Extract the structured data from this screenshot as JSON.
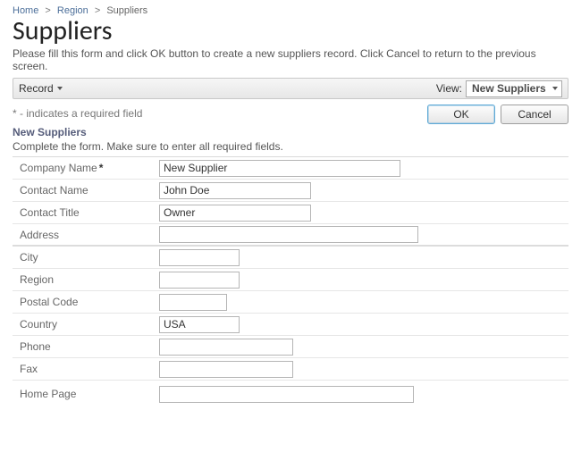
{
  "breadcrumb": {
    "home": "Home",
    "region": "Region",
    "current": "Suppliers"
  },
  "title": "Suppliers",
  "instructions": "Please fill this form and click OK button to create a new suppliers record. Click Cancel to return to the previous screen.",
  "toolbar": {
    "record_label": "Record",
    "view_label": "View:",
    "view_value": "New Suppliers"
  },
  "actions": {
    "required_note": "* - indicates a required field",
    "ok_label": "OK",
    "cancel_label": "Cancel"
  },
  "section": {
    "title": "New Suppliers",
    "subtitle": "Complete the form. Make sure to enter all required fields."
  },
  "form": {
    "company_name": {
      "label": "Company Name",
      "value": "New Supplier",
      "required": true
    },
    "contact_name": {
      "label": "Contact Name",
      "value": "John Doe"
    },
    "contact_title": {
      "label": "Contact Title",
      "value": "Owner"
    },
    "address": {
      "label": "Address",
      "value": ""
    },
    "city": {
      "label": "City",
      "value": ""
    },
    "region": {
      "label": "Region",
      "value": ""
    },
    "postal_code": {
      "label": "Postal Code",
      "value": ""
    },
    "country": {
      "label": "Country",
      "value": "USA"
    },
    "phone": {
      "label": "Phone",
      "value": ""
    },
    "fax": {
      "label": "Fax",
      "value": ""
    },
    "home_page": {
      "label": "Home Page",
      "value": ""
    }
  }
}
